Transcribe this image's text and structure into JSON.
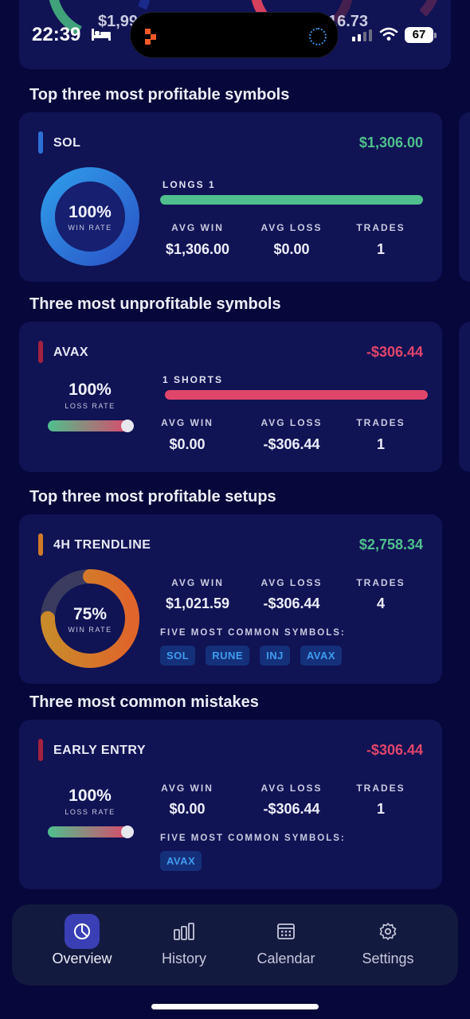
{
  "status_bar": {
    "time": "22:39",
    "battery": "67"
  },
  "top_card": {
    "left_value": "$1,99",
    "right_value": "16.73"
  },
  "sections": {
    "profitable_symbols": "Top three most profitable symbols",
    "unprofitable_symbols": "Three most unprofitable symbols",
    "profitable_setups": "Top three most profitable setups",
    "common_mistakes": "Three most common mistakes"
  },
  "labels": {
    "avg_win": "AVG WIN",
    "avg_loss": "AVG LOSS",
    "trades": "TRADES",
    "win_rate": "WIN RATE",
    "loss_rate": "LOSS RATE",
    "five_symbols": "FIVE MOST COMMON SYMBOLS:"
  },
  "sol_card": {
    "name": "SOL",
    "amount": "$1,306.00",
    "rate": "100%",
    "rate_fraction": 1.0,
    "bar_label": "LONGS 1",
    "avg_win": "$1,306.00",
    "avg_loss": "$0.00",
    "trades": "1",
    "tag_color": "#2d6fd6",
    "ring_color": "#2f8be0"
  },
  "avax_card": {
    "name": "AVAX",
    "amount": "-$306.44",
    "rate": "100%",
    "loss_fraction": 1.0,
    "bar_label": "1 SHORTS",
    "avg_win": "$0.00",
    "avg_loss": "-$306.44",
    "trades": "1",
    "tag_color": "#a3223f"
  },
  "setup_card": {
    "name": "4H TRENDLINE",
    "amount": "$2,758.34",
    "rate": "75%",
    "rate_fraction": 0.75,
    "avg_win": "$1,021.59",
    "avg_loss": "-$306.44",
    "trades": "4",
    "symbols": [
      "SOL",
      "RUNE",
      "INJ",
      "AVAX"
    ],
    "tag_color": "#d07a28"
  },
  "mistake_card": {
    "name": "EARLY ENTRY",
    "amount": "-$306.44",
    "rate": "100%",
    "loss_fraction": 1.0,
    "avg_win": "$0.00",
    "avg_loss": "-$306.44",
    "trades": "1",
    "symbols": [
      "AVAX"
    ],
    "tag_color": "#a3223f"
  },
  "tabs": [
    {
      "label": "Overview",
      "icon": "pie-chart-icon",
      "active": true
    },
    {
      "label": "History",
      "icon": "bar-chart-icon",
      "active": false
    },
    {
      "label": "Calendar",
      "icon": "calendar-icon",
      "active": false
    },
    {
      "label": "Settings",
      "icon": "gear-icon",
      "active": false
    }
  ],
  "colors": {
    "green": "#4fbf8d",
    "red": "#e0456a",
    "background": "#06073a",
    "card": "#101354",
    "chip_text": "#3f9cf0"
  }
}
